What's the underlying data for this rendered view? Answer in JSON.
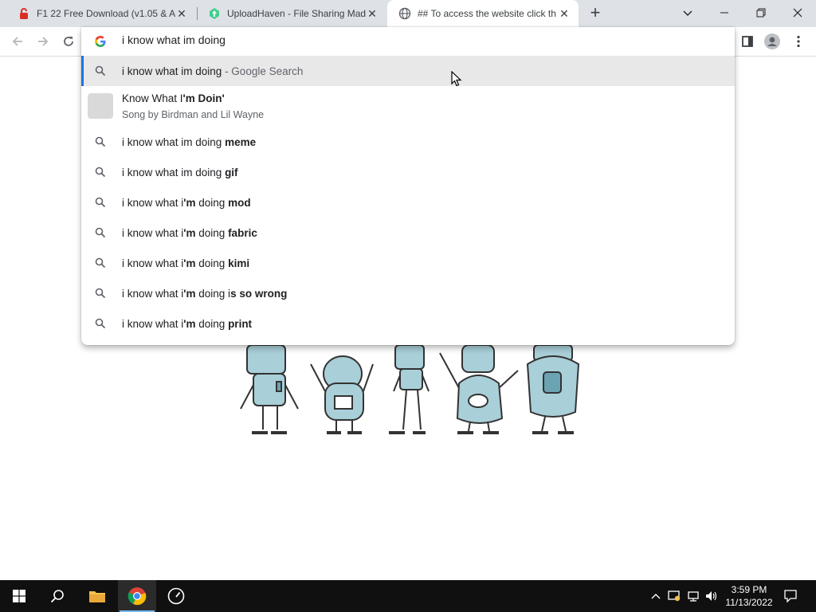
{
  "tabs": [
    {
      "title": "F1 22 Free Download (v1.05 & Al",
      "favicon": "red-lock-icon"
    },
    {
      "title": "UploadHaven - File Sharing Mad",
      "favicon": "uploadhaven-icon"
    },
    {
      "title": "## To access the website click th",
      "favicon": "globe-icon",
      "active": true
    }
  ],
  "omnibox": {
    "value": "i know what im doing",
    "search_engine_icon": "google-g-icon"
  },
  "suggestions": {
    "top": {
      "query": "i know what im doing",
      "suffix": " - Google Search"
    },
    "entity": {
      "title_prefix": "Know What I",
      "title_bold": "'m Doin'",
      "subtitle": "Song by Birdman and Lil Wayne"
    },
    "items": [
      {
        "plain": "i know what im doing ",
        "bold": "meme"
      },
      {
        "plain": "i know what im doing ",
        "bold": "gif"
      },
      {
        "plain": "i know what i",
        "bold": "'m",
        "plain2": " doing ",
        "bold2": "mod"
      },
      {
        "plain": "i know what i",
        "bold": "'m",
        "plain2": " doing ",
        "bold2": "fabric"
      },
      {
        "plain": "i know what i",
        "bold": "'m",
        "plain2": " doing ",
        "bold2": "kimi"
      },
      {
        "plain": "i know what i",
        "bold": "'m",
        "plain2": " doing i",
        "bold2": "s so wrong"
      },
      {
        "plain": "i know what i",
        "bold": "'m",
        "plain2": " doing ",
        "bold2": "print"
      }
    ]
  },
  "taskbar": {
    "time": "3:59 PM",
    "date": "11/13/2022"
  },
  "colors": {
    "tabstrip": "#dee1e6",
    "selected_row": "#e8e8e9",
    "accent": "#1a73e8",
    "robot_fill": "#a9cfd8",
    "taskbar": "#101010"
  }
}
